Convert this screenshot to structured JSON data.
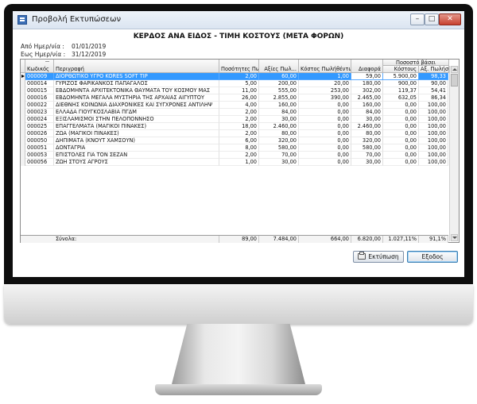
{
  "window": {
    "title": "Προβολή Εκτυπώσεων"
  },
  "report": {
    "title": "ΚΕΡΔΟΣ ΑΝΑ ΕΙΔΟΣ - ΤΙΜΗ ΚΟΣΤΟΥΣ (ΜΕΤΑ ΦΟΡΩΝ)",
    "from_label": "Από Ημερ/νία :",
    "from_date": "01/01/2019",
    "to_label": "Εως Ημερ/νία :",
    "to_date": "31/12/2019"
  },
  "grid": {
    "group_header": "Ποσοστό βάσει",
    "columns": {
      "code": "Κωδικός",
      "description": "Περιγραφή",
      "qty": "Ποσότητες Πωλήσ...",
      "sales": "Αξίες Πωλ...",
      "cost": "Κόστος Πωλήθέντων",
      "margin": "Διαφορά",
      "pct_cost": "Κόστους",
      "pct_sales": "Αξ. Πωλήσεων"
    },
    "selected_row": 0,
    "rows": [
      {
        "code": "000009",
        "description": "ΔΙΟΡΘΩΤΙΚΟ ΥΓΡΟ KORES SOFT TIP",
        "qty": "2,00",
        "sales": "60,00",
        "cost": "1,00",
        "margin": "59,00",
        "pct_cost": "5.900,00",
        "pct_sales": "98,33"
      },
      {
        "code": "000014",
        "description": "ΓΥΡΙΖΟΣ ΦΑΡΙΚΑΝΚΟΣ ΠΑΠΑΓΑΛΟΣ",
        "qty": "5,00",
        "sales": "200,00",
        "cost": "20,00",
        "margin": "180,00",
        "pct_cost": "900,00",
        "pct_sales": "90,00"
      },
      {
        "code": "000015",
        "description": "ΕΒΔΟΜΗΝΤΑ ΑΡΧΙΤΕΚΤΟΝΙΚΑ ΘΑΥΜΑΤΑ ΤΟΥ ΚΟΣΜΟΥ ΜΑΣ",
        "qty": "11,00",
        "sales": "555,00",
        "cost": "253,00",
        "margin": "302,00",
        "pct_cost": "119,37",
        "pct_sales": "54,41"
      },
      {
        "code": "000016",
        "description": "ΕΒΔΟΜΗΝΤΑ ΜΕΓΑΛΑ ΜΥΣΤΗΡΙΑ ΤΗΣ ΑΡΧΑΙΑΣ ΑΙΓΥΠΤΟΥ",
        "qty": "26,00",
        "sales": "2.855,00",
        "cost": "390,00",
        "margin": "2.465,00",
        "pct_cost": "632,05",
        "pct_sales": "86,34"
      },
      {
        "code": "000022",
        "description": "ΔΙΕΘΝΗΣ ΚΟΙΝΩΝΙΑ ΔΙΑΧΡΟΝΙΚΕΣ ΚΑΙ ΣΥΓΧΡΟΝΕΣ ΑΝΤΙΛΗΨ",
        "qty": "4,00",
        "sales": "160,00",
        "cost": "0,00",
        "margin": "160,00",
        "pct_cost": "0,00",
        "pct_sales": "100,00"
      },
      {
        "code": "000023",
        "description": "ΕΛΛΑΔΑ ΓΙΟΥΓΚΟΣΛΑΒΙΑ ΠΓΔΜ",
        "qty": "2,00",
        "sales": "84,00",
        "cost": "0,00",
        "margin": "84,00",
        "pct_cost": "0,00",
        "pct_sales": "100,00"
      },
      {
        "code": "000024",
        "description": "ΕΞΙΣΛΑΜΙΣΜΟΙ ΣΤΗΝ ΠΕΛΟΠΟΝΝΗΣΟ",
        "qty": "2,00",
        "sales": "30,00",
        "cost": "0,00",
        "margin": "30,00",
        "pct_cost": "0,00",
        "pct_sales": "100,00"
      },
      {
        "code": "000025",
        "description": "ΕΠΑΓΓΕΛΜΑΤΑ (ΜΑΓΙΚΟΙ ΠΙΝΑΚΕΣ)",
        "qty": "18,00",
        "sales": "2.460,00",
        "cost": "0,00",
        "margin": "2.460,00",
        "pct_cost": "0,00",
        "pct_sales": "100,00"
      },
      {
        "code": "000026",
        "description": "ΖΩΑ (ΜΑΓΙΚΟΙ ΠΙΝΑΚΕΣ)",
        "qty": "2,00",
        "sales": "80,00",
        "cost": "0,00",
        "margin": "80,00",
        "pct_cost": "0,00",
        "pct_sales": "100,00"
      },
      {
        "code": "000050",
        "description": "ΔΗΠΙΜΑΤΑ (ΚΝΟΥΤ ΧΑΜΣΟΥΝ)",
        "qty": "6,00",
        "sales": "320,00",
        "cost": "0,00",
        "margin": "320,00",
        "pct_cost": "0,00",
        "pct_sales": "100,00"
      },
      {
        "code": "000051",
        "description": "ΔΟΝΤΑΓΡΙΑ",
        "qty": "8,00",
        "sales": "580,00",
        "cost": "0,00",
        "margin": "580,00",
        "pct_cost": "0,00",
        "pct_sales": "100,00"
      },
      {
        "code": "000053",
        "description": "ΕΠΙΣΤΟΛΕΣ ΓΙΑ ΤΟΝ ΣΕΖΑΝ",
        "qty": "2,00",
        "sales": "70,00",
        "cost": "0,00",
        "margin": "70,00",
        "pct_cost": "0,00",
        "pct_sales": "100,00"
      },
      {
        "code": "000056",
        "description": "ΖΩΗ ΣΤΟΥΣ ΑΓΡΟΥΣ",
        "qty": "1,00",
        "sales": "30,00",
        "cost": "0,00",
        "margin": "30,00",
        "pct_cost": "0,00",
        "pct_sales": "100,00"
      }
    ],
    "totals": {
      "label": "Σύνολα:",
      "qty": "89,00",
      "sales": "7.484,00",
      "cost": "664,00",
      "margin": "6.820,00",
      "pct_cost": "1.027,11%",
      "pct_sales": "91,1%"
    }
  },
  "buttons": {
    "print": "Εκτύπωση",
    "exit": "Εξοδος"
  }
}
